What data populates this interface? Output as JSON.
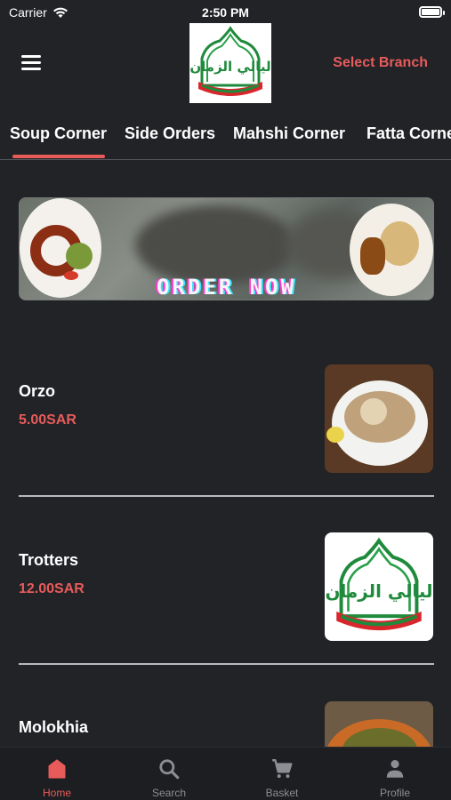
{
  "status_bar": {
    "carrier": "Carrier",
    "time": "2:50 PM"
  },
  "header": {
    "menu_icon": "hamburger-menu-icon",
    "logo_alt": "ليالي الزمان",
    "select_branch": "Select Branch"
  },
  "tabs": [
    {
      "label": "Soup Corner",
      "active": true
    },
    {
      "label": "Side Orders",
      "active": false
    },
    {
      "label": "Mahshi Corner",
      "active": false
    },
    {
      "label": "Fatta Corner",
      "active": false
    }
  ],
  "banner": {
    "text": "ORDER NOW"
  },
  "items": [
    {
      "name": "Orzo",
      "price": "5.00SAR"
    },
    {
      "name": "Trotters",
      "price": "12.00SAR"
    },
    {
      "name": "Molokhia",
      "price": ""
    }
  ],
  "bottom_nav": [
    {
      "label": "Home",
      "icon": "home-icon",
      "active": true
    },
    {
      "label": "Search",
      "icon": "search-icon",
      "active": false
    },
    {
      "label": "Basket",
      "icon": "cart-icon",
      "active": false
    },
    {
      "label": "Profile",
      "icon": "person-icon",
      "active": false
    }
  ],
  "colors": {
    "accent": "#e85b5b",
    "background": "#222327",
    "nav_background": "#1d1e21"
  }
}
